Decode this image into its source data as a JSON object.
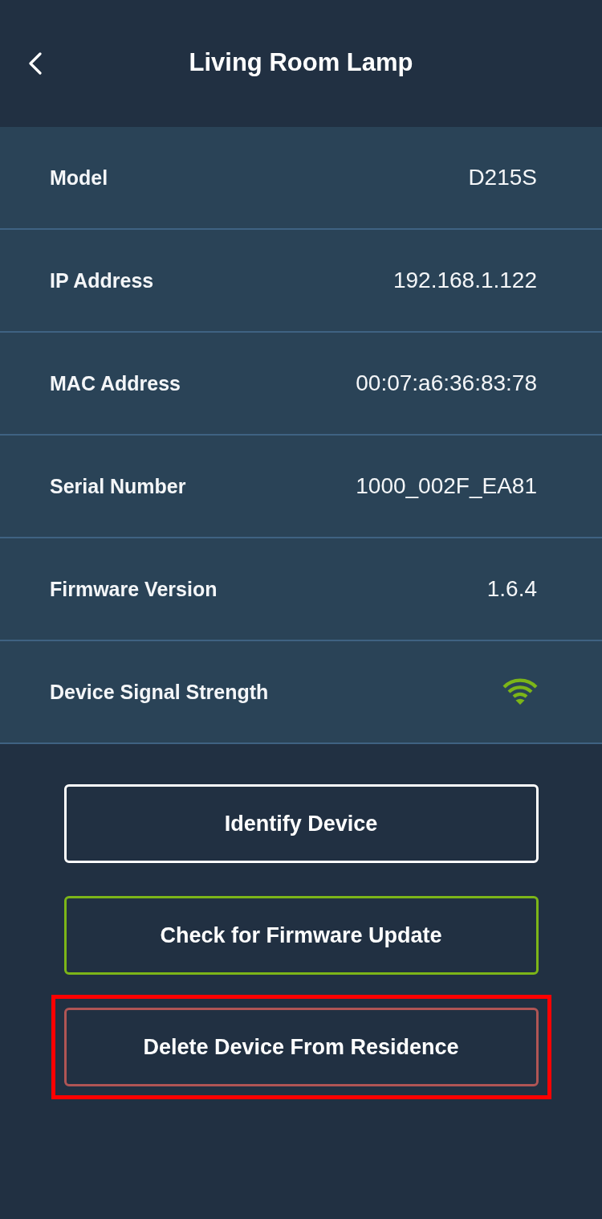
{
  "header": {
    "title": "Living Room Lamp"
  },
  "details": [
    {
      "kind": "text",
      "label": "Model",
      "value": "D215S"
    },
    {
      "kind": "text",
      "label": "IP Address",
      "value": "192.168.1.122"
    },
    {
      "kind": "text",
      "label": "MAC Address",
      "value": "00:07:a6:36:83:78"
    },
    {
      "kind": "text",
      "label": "Serial Number",
      "value": "1000_002F_EA81"
    },
    {
      "kind": "text",
      "label": "Firmware Version",
      "value": "1.6.4"
    },
    {
      "kind": "signal",
      "label": "Device Signal Strength"
    }
  ],
  "buttons": [
    {
      "label": "Identify Device",
      "color": "#ffffff",
      "highlighted": false
    },
    {
      "label": "Check for Firmware Update",
      "color": "#7cb518",
      "highlighted": false
    },
    {
      "label": "Delete Device From Residence",
      "color": "#b05555",
      "highlighted": true
    }
  ]
}
